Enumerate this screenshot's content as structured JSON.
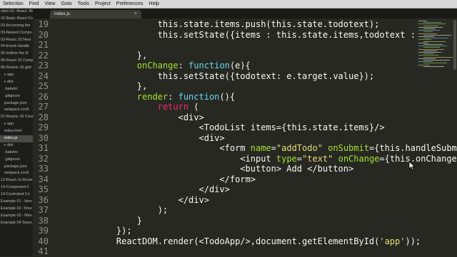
{
  "menu": [
    "Selection",
    "Find",
    "View",
    "Goto",
    "Tools",
    "Project",
    "Preferences",
    "Help"
  ],
  "sidebar_items": [
    {
      "label": "ction-02 -React: Be",
      "folder": false
    },
    {
      "label": "02-Basic React Co",
      "folder": false
    },
    {
      "label": "03-Accessing the",
      "folder": false
    },
    {
      "label": "03-Nested Compo",
      "folder": false
    },
    {
      "label": "03-React JS Nest",
      "folder": false
    },
    {
      "label": "04-Event Handle",
      "folder": false
    },
    {
      "label": "05-Initilize the R",
      "folder": false
    },
    {
      "label": "06-React JS Comp",
      "folder": false
    },
    {
      "label": "06-Reacts JS getI",
      "folder": false
    },
    {
      "label": "app",
      "folder": true
    },
    {
      "label": "dist",
      "folder": true
    },
    {
      "label": ".babelrc",
      "folder": false
    },
    {
      "label": ".gitignore",
      "folder": false
    },
    {
      "label": "package.json",
      "folder": false
    },
    {
      "label": "webpack.confi",
      "folder": false
    },
    {
      "label": "07-Reacts JS Creat",
      "folder": false
    },
    {
      "label": "app",
      "folder": true
    },
    {
      "label": "index.html",
      "folder": false
    },
    {
      "label": "index.js",
      "folder": false,
      "selected": true
    },
    {
      "label": "dist",
      "folder": true
    },
    {
      "label": ".babelrc",
      "folder": false
    },
    {
      "label": ".gitignore",
      "folder": false
    },
    {
      "label": "package.json",
      "folder": false
    },
    {
      "label": "webpack.confi",
      "folder": false
    },
    {
      "label": "12-React Js Route",
      "folder": false
    },
    {
      "label": "14-Component li",
      "folder": false
    },
    {
      "label": "14-Controlled Co",
      "folder": false
    },
    {
      "label": "Example 01 - Item",
      "folder": false
    },
    {
      "label": "Example 02 -Time",
      "folder": false
    },
    {
      "label": "Example 03 - Men",
      "folder": false
    },
    {
      "label": "Example 04 Searc",
      "folder": false
    }
  ],
  "tab": {
    "label": "index.js",
    "close": "×"
  },
  "line_numbers": [
    "19",
    "20",
    "21",
    "22",
    "23",
    "24",
    "25",
    "26",
    "27",
    "28",
    "29",
    "30",
    "31",
    "32",
    "33",
    "34",
    "35",
    "36",
    "37",
    "38",
    "39",
    "40",
    "41"
  ],
  "code_lines": [
    [
      {
        "t": "            this.state.items.push(this.state.todotext);"
      }
    ],
    [
      {
        "t": "            this.setState({items : this.state.items,todotext : "
      },
      {
        "t": "''",
        "c": "str"
      },
      {
        "t": "});"
      }
    ],
    [
      {
        "t": ""
      }
    ],
    [
      {
        "t": "        },"
      }
    ],
    [
      {
        "t": "        "
      },
      {
        "t": "onChange",
        "c": "fn"
      },
      {
        "t": ": "
      },
      {
        "t": "function",
        "c": "key"
      },
      {
        "t": "(e){"
      }
    ],
    [
      {
        "t": "            this.setState({todotext: e.target.value});"
      }
    ],
    [
      {
        "t": "        },"
      }
    ],
    [
      {
        "t": "        "
      },
      {
        "t": "render",
        "c": "fn"
      },
      {
        "t": ": "
      },
      {
        "t": "function",
        "c": "key"
      },
      {
        "t": "(){"
      }
    ],
    [
      {
        "t": "            "
      },
      {
        "t": "return",
        "c": "kw"
      },
      {
        "t": " ("
      }
    ],
    [
      {
        "t": "                <div>"
      }
    ],
    [
      {
        "t": "                    <TodoList items={this.state.items}/>"
      }
    ],
    [
      {
        "t": "                    <div>"
      }
    ],
    [
      {
        "t": "                        <form "
      },
      {
        "t": "name",
        "c": "attr"
      },
      {
        "t": "="
      },
      {
        "t": "\"addTodo\"",
        "c": "str"
      },
      {
        "t": " "
      },
      {
        "t": "onSubmit",
        "c": "attr"
      },
      {
        "t": "={this.handleSubmit"
      }
    ],
    [
      {
        "t": "                            <input "
      },
      {
        "t": "type",
        "c": "attr"
      },
      {
        "t": "="
      },
      {
        "t": "\"text\"",
        "c": "str"
      },
      {
        "t": " "
      },
      {
        "t": "onChange",
        "c": "attr"
      },
      {
        "t": "={this.onChange}"
      }
    ],
    [
      {
        "t": "                            <button> Add </button>"
      }
    ],
    [
      {
        "t": "                        </form>"
      }
    ],
    [
      {
        "t": "                    </div>"
      }
    ],
    [
      {
        "t": "                </div>"
      }
    ],
    [
      {
        "t": "            );"
      }
    ],
    [
      {
        "t": "        }"
      }
    ],
    [
      {
        "t": "    });"
      }
    ],
    [
      {
        "t": "    ReactDOM.render(<TodoApp/>,document.getElementById("
      },
      {
        "t": "'app'",
        "c": "str"
      },
      {
        "t": "));"
      }
    ],
    [
      {
        "t": ""
      }
    ]
  ],
  "colors": {
    "background": "#272822",
    "foreground": "#f8f8f2",
    "keyword": "#66d9ef",
    "string": "#e6db74",
    "function": "#a6e22e",
    "control": "#f92672"
  },
  "icons": {
    "cursor": "mouse-pointer-icon",
    "folder": "folder-arrow-icon"
  }
}
